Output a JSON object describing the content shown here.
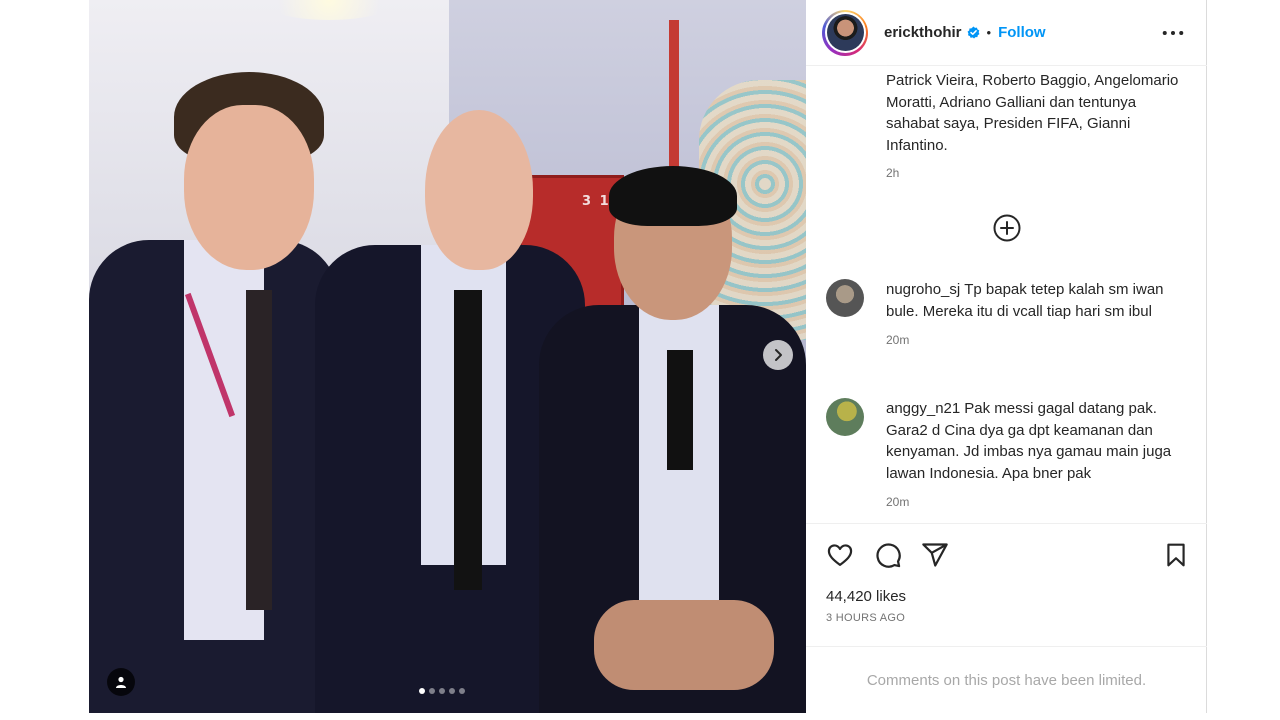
{
  "post": {
    "slide_count": 5,
    "active_slide": 1,
    "door_number": "3 1"
  },
  "header": {
    "username": "erickthohir",
    "separator": "•",
    "follow_label": "Follow",
    "verified": true,
    "avatar_icon": "profile-avatar",
    "more_icon": "more-options-icon"
  },
  "caption": {
    "text": "Patrick Vieira, Roberto Baggio, Angelomario Moratti, Adriano Galliani dan tentunya sahabat saya, Presiden FIFA, Gianni Infantino.",
    "time": "2h"
  },
  "load_more_icon": "plus-circle-icon",
  "comments": [
    {
      "username": "nugroho_sj",
      "text": "Tp bapak tetep kalah sm iwan bule. Mereka itu di vcall tiap hari sm ibul",
      "time": "20m"
    },
    {
      "username": "anggy_n21",
      "text": "Pak messi gagal datang pak. Gara2 d Cina dya ga dpt keamanan dan kenyaman. Jd imbas nya gamau main juga lawan Indonesia. Apa bner pak",
      "time": "20m"
    }
  ],
  "actions": {
    "like_icon": "heart-icon",
    "comment_icon": "comment-bubble-icon",
    "share_icon": "send-icon",
    "save_icon": "bookmark-icon"
  },
  "likes": "44,420 likes",
  "post_age": "3 HOURS AGO",
  "comments_limited": "Comments on this post have been limited.",
  "colors": {
    "accent": "#0095f6",
    "verified_badge": "#0095f6",
    "text": "#262626",
    "muted": "#737373"
  }
}
